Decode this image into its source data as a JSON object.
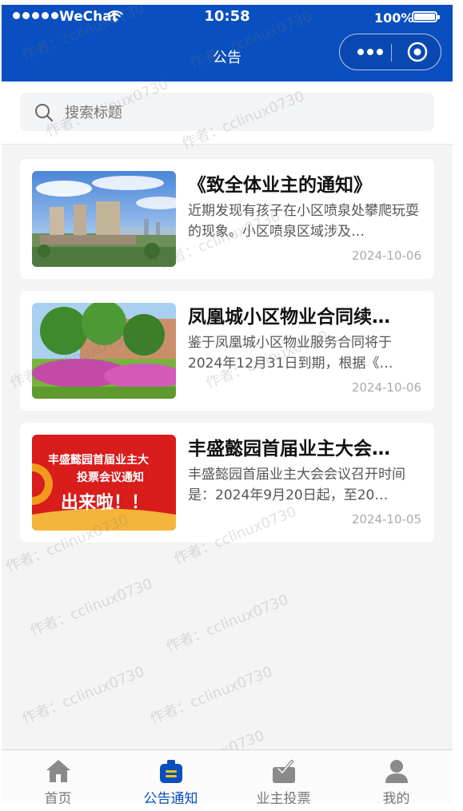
{
  "status_bar": {
    "carrier": "WeChat",
    "time": "10:58",
    "battery": "100%"
  },
  "header": {
    "title": "公告",
    "more_icon": "more-dots-icon",
    "close_icon": "mini-program-close-icon"
  },
  "search": {
    "placeholder": "搜索标题",
    "icon": "search-icon"
  },
  "notices": [
    {
      "title": "《致全体业主的通知》",
      "summary": "近期发现有孩子在小区喷泉处攀爬玩耍的现象。小区喷泉区域涉及…",
      "date": "2024-10-06"
    },
    {
      "title": "凤凰城小区物业合同续…",
      "summary": "鉴于凤凰城小区物业服务合同将于2024年12月31日到期，根据《…",
      "date": "2024-10-06"
    },
    {
      "title": "丰盛懿园首届业主大会…",
      "summary": "丰盛懿园首届业主大会会议召开时间是：2024年9月20日起，至20…",
      "date": "2024-10-05",
      "thumb_text_line1": "丰盛懿园首届业主大",
      "thumb_text_line2": "投票会议通知",
      "thumb_text_line3": "出来啦！！"
    }
  ],
  "tabbar": {
    "items": [
      {
        "label": "首页",
        "icon": "home-icon",
        "active": false
      },
      {
        "label": "公告通知",
        "icon": "notice-icon",
        "active": true
      },
      {
        "label": "业主投票",
        "icon": "vote-icon",
        "active": false
      },
      {
        "label": "我的",
        "icon": "profile-icon",
        "active": false
      }
    ]
  },
  "watermark": "作者：cclinux0730",
  "colors": {
    "brand": "#0a4fbf",
    "background": "#f4f4f4",
    "date_text": "#aaaaaa"
  }
}
